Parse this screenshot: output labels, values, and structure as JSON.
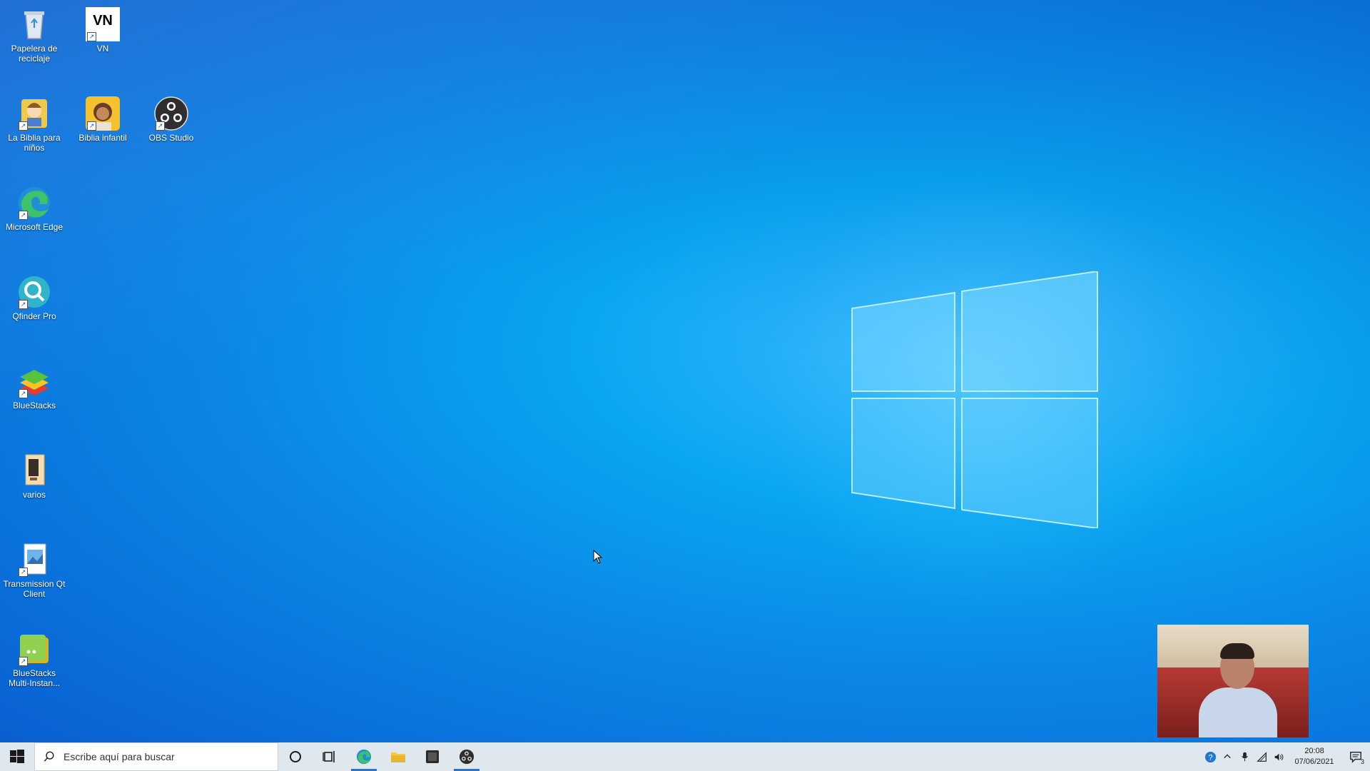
{
  "desktop": {
    "icons": [
      {
        "label": "Papelera de reciclaje",
        "name": "recycle-bin"
      },
      {
        "label": "VN",
        "name": "vn"
      },
      {
        "label": "La Biblia para niños",
        "name": "la-biblia-para-ninos"
      },
      {
        "label": "Biblia infantil",
        "name": "biblia-infantil"
      },
      {
        "label": "OBS Studio",
        "name": "obs-studio"
      },
      {
        "label": "Microsoft Edge",
        "name": "microsoft-edge"
      },
      {
        "label": "Qfinder Pro",
        "name": "qfinder-pro"
      },
      {
        "label": "BlueStacks",
        "name": "bluestacks"
      },
      {
        "label": "varios",
        "name": "varios"
      },
      {
        "label": "Transmission Qt Client",
        "name": "transmission-qt-client"
      },
      {
        "label": "BlueStacks Multi-Instan...",
        "name": "bluestacks-multi-instance"
      }
    ],
    "vn_logo_text": "VN"
  },
  "taskbar": {
    "search_placeholder": "Escribe aquí para buscar",
    "pinned": [
      "start",
      "search",
      "cortana",
      "task-view",
      "edge",
      "file-explorer",
      "app",
      "obs-studio"
    ],
    "clock": {
      "time": "20:08",
      "date": "07/06/2021"
    },
    "notification_count": "3"
  },
  "colors": {
    "taskbar_bg": "#dfe7ef",
    "accent": "#1e78d6",
    "desktop_blue": "#0aa6f0"
  }
}
